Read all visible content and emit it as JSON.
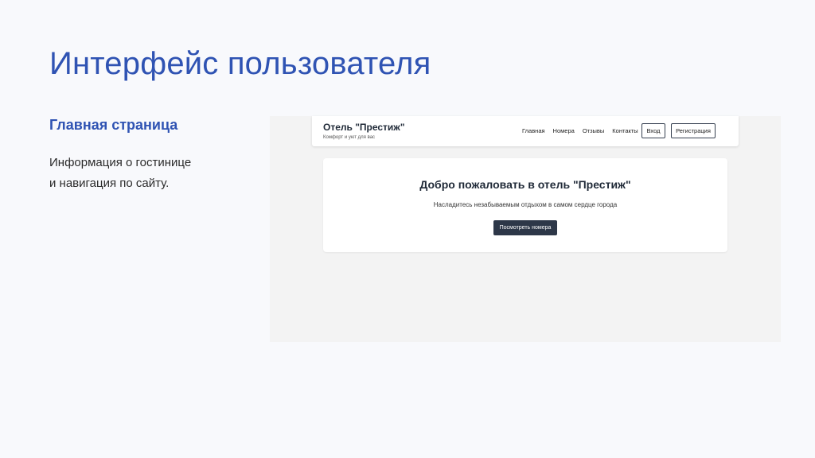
{
  "slide": {
    "title": "Интерфейс пользователя",
    "subtitle": "Главная страница",
    "description_lines": [
      "Информация о гостинице",
      "и навигация по сайту."
    ]
  },
  "site": {
    "brand": {
      "name": "Отель \"Престиж\"",
      "tagline": "Комфорт и уют для вас"
    },
    "nav": [
      "Главная",
      "Номера",
      "Отзывы",
      "Контакты"
    ],
    "login_label": "Вход",
    "register_label": "Регистрация",
    "hero": {
      "title": "Добро пожаловать в отель \"Престиж\"",
      "subtitle": "Насладитесь незабываемым отдыхом в самом сердце города",
      "button_label": "Посмотреть номера"
    }
  },
  "colors": {
    "accent": "#2f53b3",
    "dark_button": "#2d3748",
    "background": "#f8f9fc"
  }
}
